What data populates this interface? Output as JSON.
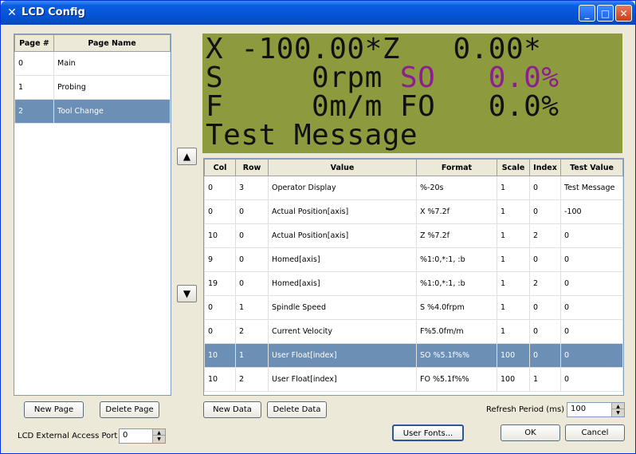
{
  "window": {
    "title": "LCD Config",
    "icon": "x-logo-icon"
  },
  "pages": {
    "columns": [
      "Page #",
      "Page Name"
    ],
    "rows": [
      {
        "num": "0",
        "name": "Main"
      },
      {
        "num": "1",
        "name": "Probing"
      },
      {
        "num": "2",
        "name": "Tool Change"
      }
    ],
    "selected": 2
  },
  "lcd": {
    "lines": [
      {
        "a": "X -100.00*Z   ",
        "b": "",
        "c": "0.00*"
      },
      {
        "a": "S     0rpm ",
        "b": "SO   0.0%",
        "c": ""
      },
      {
        "a": "F     0m/m FO   0.0%",
        "b": "",
        "c": ""
      },
      {
        "a": "Test Message",
        "b": "",
        "c": ""
      }
    ],
    "bg_color": "#8d9a3e",
    "highlight_color": "#8b1f8f"
  },
  "data_table": {
    "columns": [
      "Col",
      "Row",
      "Value",
      "Format",
      "Scale",
      "Index",
      "Test Value"
    ],
    "rows": [
      {
        "col": "0",
        "row": "3",
        "value": "Operator Display",
        "format": "%-20s",
        "scale": "1",
        "index": "0",
        "test": "Test Message"
      },
      {
        "col": "0",
        "row": "0",
        "value": "Actual Position[axis]",
        "format": "X %7.2f",
        "scale": "1",
        "index": "0",
        "test": "-100"
      },
      {
        "col": "10",
        "row": "0",
        "value": "Actual Position[axis]",
        "format": "Z %7.2f",
        "scale": "1",
        "index": "2",
        "test": "0"
      },
      {
        "col": "9",
        "row": "0",
        "value": "Homed[axis]",
        "format": "%1:0,*:1, :b",
        "scale": "1",
        "index": "0",
        "test": "0"
      },
      {
        "col": "19",
        "row": "0",
        "value": "Homed[axis]",
        "format": "%1:0,*:1, :b",
        "scale": "1",
        "index": "2",
        "test": "0"
      },
      {
        "col": "0",
        "row": "1",
        "value": "Spindle Speed",
        "format": "S %4.0frpm",
        "scale": "1",
        "index": "0",
        "test": "0"
      },
      {
        "col": "0",
        "row": "2",
        "value": "Current Velocity",
        "format": "F%5.0fm/m",
        "scale": "1",
        "index": "0",
        "test": "0"
      },
      {
        "col": "10",
        "row": "1",
        "value": "User Float[index]",
        "format": "SO %5.1f%%",
        "scale": "100",
        "index": "0",
        "test": "0"
      },
      {
        "col": "10",
        "row": "2",
        "value": "User Float[index]",
        "format": "FO %5.1f%%",
        "scale": "100",
        "index": "1",
        "test": "0"
      }
    ],
    "selected": 7
  },
  "buttons": {
    "new_page": "New Page",
    "delete_page": "Delete Page",
    "new_data": "New Data",
    "delete_data": "Delete Data",
    "user_fonts": "User Fonts...",
    "ok": "OK",
    "cancel": "Cancel"
  },
  "fields": {
    "external_port_label": "LCD External Access Port",
    "external_port_value": "0",
    "refresh_label": "Refresh Period (ms)",
    "refresh_value": "100"
  }
}
